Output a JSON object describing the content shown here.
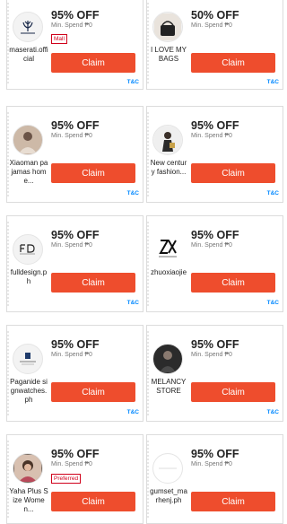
{
  "vouchers": [
    {
      "title": "95% OFF",
      "min_spend": "Min. Spend ₱0",
      "shop": "maserati.official",
      "tag": "Mall",
      "claim": "Claim",
      "tc": "T&C",
      "avatar_icon": "maserati-trident-icon",
      "avatar_style": "light"
    },
    {
      "title": "50% OFF",
      "min_spend": "Min. Spend ₱0",
      "shop": "I LOVE MY BAGS",
      "tag": "",
      "claim": "Claim",
      "tc": "T&C",
      "avatar_icon": "handbag-photo-icon",
      "avatar_style": "light"
    },
    {
      "title": "95% OFF",
      "min_spend": "Min. Spend ₱0",
      "shop": "Xiaoman pajamas home...",
      "tag": "",
      "claim": "Claim",
      "tc": "T&C",
      "avatar_icon": "person-photo-icon",
      "avatar_style": "tan"
    },
    {
      "title": "95% OFF",
      "min_spend": "Min. Spend ₱0",
      "shop": "New century fashion...",
      "tag": "",
      "claim": "Claim",
      "tc": "T&C",
      "avatar_icon": "person-photo-icon",
      "avatar_style": "light"
    },
    {
      "title": "95% OFF",
      "min_spend": "Min. Spend ₱0",
      "shop": "fulldesign.ph",
      "tag": "",
      "claim": "Claim",
      "tc": "T&C",
      "avatar_icon": "fd-logo-icon",
      "avatar_style": "light"
    },
    {
      "title": "95% OFF",
      "min_spend": "Min. Spend ₱0",
      "shop": "zhuoxiaojie",
      "tag": "",
      "claim": "Claim",
      "tc": "T&C",
      "avatar_icon": "zx-logo-icon",
      "avatar_style": "light"
    },
    {
      "title": "95% OFF",
      "min_spend": "Min. Spend ₱0",
      "shop": "Paganide signwatches.ph",
      "tag": "",
      "claim": "Claim",
      "tc": "T&C",
      "avatar_icon": "watch-logo-icon",
      "avatar_style": "light"
    },
    {
      "title": "95% OFF",
      "min_spend": "Min. Spend ₱0",
      "shop": "MELANCY STORE",
      "tag": "",
      "claim": "Claim",
      "tc": "T&C",
      "avatar_icon": "person-photo-icon",
      "avatar_style": "dark"
    },
    {
      "title": "95% OFF",
      "min_spend": "Min. Spend ₱0",
      "shop": "Yaha Plus Size Women...",
      "tag": "Preferred",
      "claim": "Claim",
      "tc": "T&C",
      "avatar_icon": "person-photo-icon",
      "avatar_style": "photo"
    },
    {
      "title": "95% OFF",
      "min_spend": "Min. Spend ₱0",
      "shop": "gumset_marhenj.ph",
      "tag": "",
      "claim": "Claim",
      "tc": "T&C",
      "avatar_icon": "gumset-logo-icon",
      "avatar_style": "light"
    }
  ],
  "colors": {
    "accent": "#ee4d2d",
    "tag": "#d0011b",
    "link": "#0088ff"
  }
}
